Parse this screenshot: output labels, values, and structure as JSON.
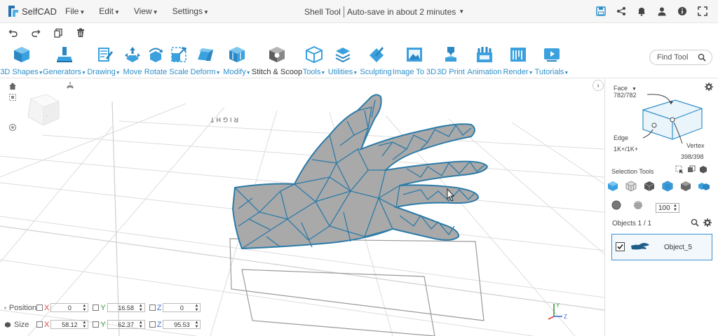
{
  "app": {
    "name": "SelfCAD"
  },
  "menu": [
    {
      "label": "File"
    },
    {
      "label": "Edit"
    },
    {
      "label": "View"
    },
    {
      "label": "Settings"
    }
  ],
  "title": {
    "tool": "Shell Tool",
    "autosave": "Auto-save in about 2 minutes"
  },
  "toolbar": [
    {
      "label": "3D Shapes",
      "caret": true
    },
    {
      "label": "Generators",
      "caret": true
    },
    {
      "label": "Drawing",
      "caret": true
    },
    {
      "label": "Move",
      "caret": false
    },
    {
      "label": "Rotate",
      "caret": false
    },
    {
      "label": "Scale",
      "caret": false
    },
    {
      "label": "Deform",
      "caret": true
    },
    {
      "label": "Modify",
      "caret": true
    },
    {
      "label": "Stitch & Scoop",
      "caret": false
    },
    {
      "label": "Tools",
      "caret": true
    },
    {
      "label": "Utilities",
      "caret": true
    },
    {
      "label": "Sculpting",
      "caret": false
    },
    {
      "label": "Image To 3D",
      "caret": false
    },
    {
      "label": "3D Print",
      "caret": false
    },
    {
      "label": "Animation",
      "caret": false
    },
    {
      "label": "Render",
      "caret": true
    },
    {
      "label": "Tutorials",
      "caret": true
    }
  ],
  "search": {
    "placeholder": "Find Tool"
  },
  "viewport": {
    "view_label": "RIGHT"
  },
  "position": {
    "label": "Position",
    "x": "0",
    "y": "16.58",
    "z": "0"
  },
  "size": {
    "label": "Size",
    "x": "58.12",
    "y": "62.37",
    "z": "95.53"
  },
  "axis_labels": {
    "x": "X",
    "y": "Y",
    "z": "Z"
  },
  "panel": {
    "face_label": "Face",
    "face_count": "782/782",
    "edge_label": "Edge",
    "edge_count": "1K+/1K+",
    "vertex_label": "Vertex",
    "vertex_count": "398/398",
    "selection_tools": "Selection Tools",
    "brush_size": "100",
    "objects_header": "Objects 1 / 1",
    "object_name": "Object_5"
  },
  "colors": {
    "accent": "#2e8fc9",
    "mesh_fill": "#a9a9a9",
    "mesh_edge": "#2c7ba8",
    "cube_blue": "#3aa0de"
  }
}
